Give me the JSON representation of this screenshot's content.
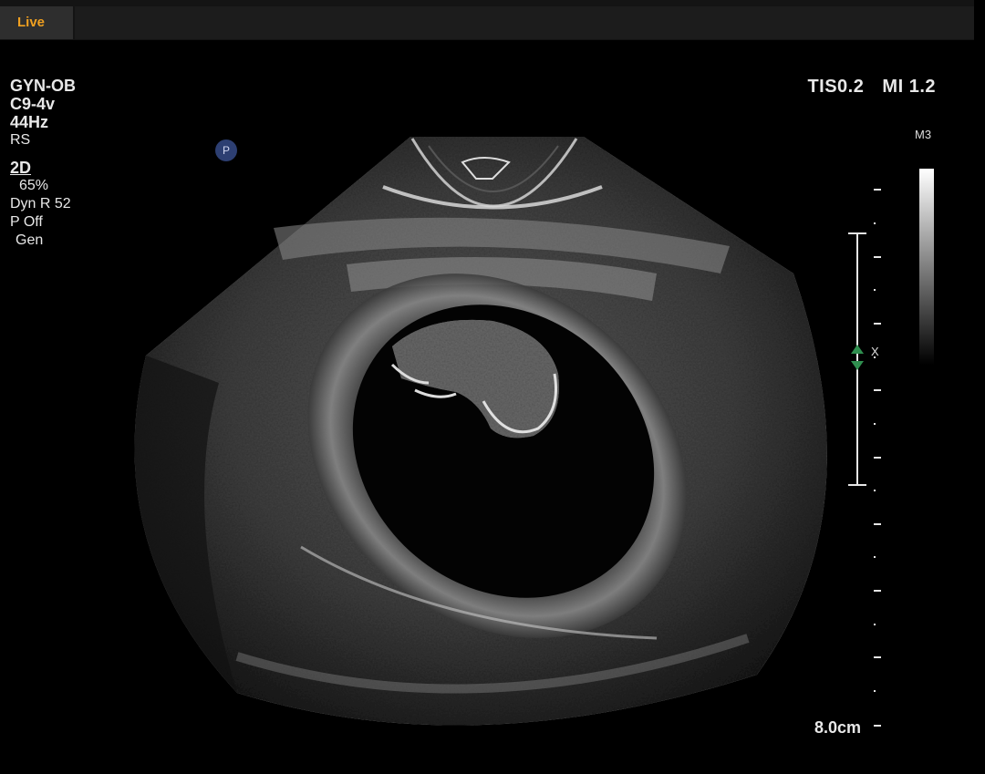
{
  "header": {
    "live_tab": "Live"
  },
  "exam": {
    "preset": "GYN-OB",
    "probe": "C9-4v",
    "frame_rate": "44Hz",
    "mode_code": "RS",
    "imaging_mode": "2D",
    "gain": "65%",
    "dynamic_range": "Dyn R 52",
    "persistence": "P Off",
    "frequency": "Gen"
  },
  "safety": {
    "tis": "TIS0.2",
    "mi": "MI 1.2"
  },
  "overlay": {
    "p_badge": "P",
    "map_label": "M3",
    "depth": "8.0cm",
    "focus_marker": "X"
  },
  "colors": {
    "live_accent": "#f0a020",
    "focus_marker": "#2f8f4f",
    "p_badge": "#2d3f72"
  },
  "icons": {
    "focus": "double-triangle-focus-icon",
    "probe_badge": "p-circle-icon"
  }
}
